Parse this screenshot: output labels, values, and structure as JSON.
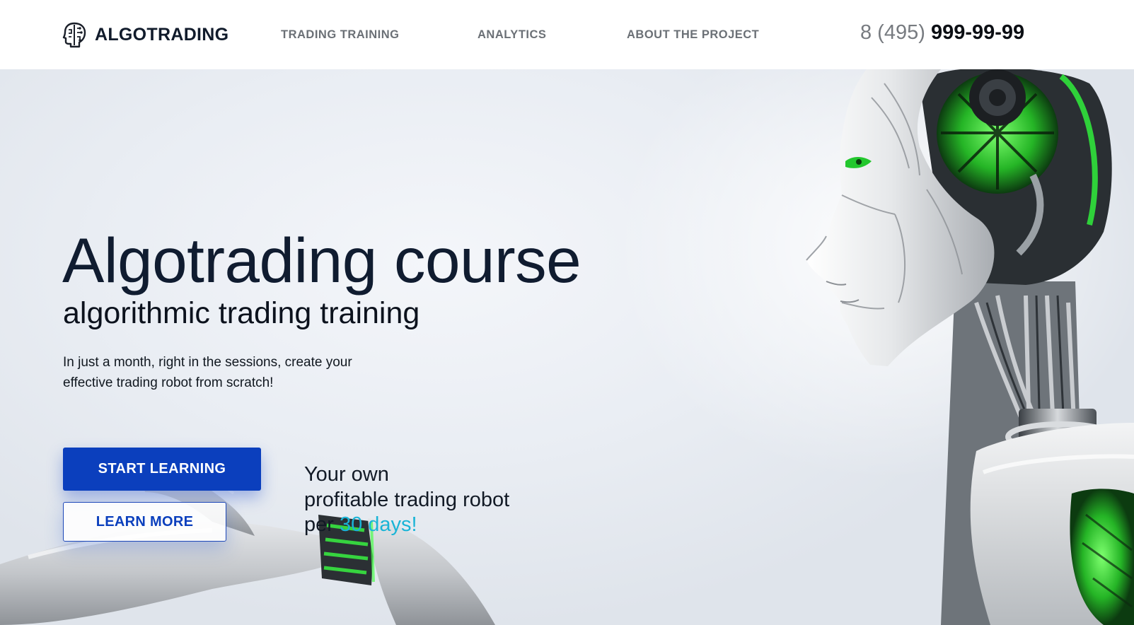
{
  "header": {
    "logo_text": "ALGOTRADING",
    "logo_icon": "brain-chip-icon",
    "nav": [
      {
        "label": "TRADING TRAINING"
      },
      {
        "label": "ANALYTICS"
      },
      {
        "label": "ABOUT THE PROJECT"
      }
    ],
    "phone": {
      "prefix": "8 (495)",
      "number": "999-99-99"
    }
  },
  "hero": {
    "title": "Algotrading course",
    "subtitle": "algorithmic trading training",
    "description": "In just a month, right in the sessions, create your effective trading robot from scratch!",
    "buttons": {
      "start_label": "START LEARNING",
      "learn_more_label": "LEARN MORE"
    },
    "tagline": {
      "line1": "Your own",
      "line2": "profitable trading robot",
      "line3_prefix": "per ",
      "line3_accent": "30 days!"
    },
    "image": "robot-illustration"
  },
  "colors": {
    "primary": "#0b3fbd",
    "accent": "#1ab4d6",
    "text_dark": "#101c30",
    "nav_text": "#6b7076",
    "robot_green": "#2fd13a"
  }
}
